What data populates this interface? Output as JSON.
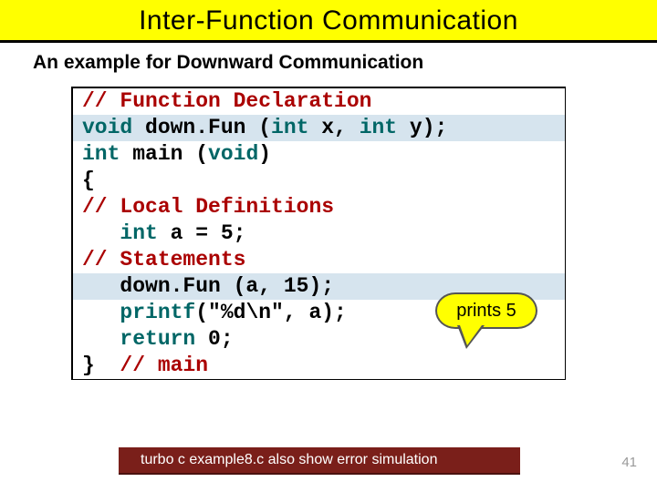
{
  "title": "Inter-Function Communication",
  "subtitle": "An example for Downward Communication",
  "code": {
    "l1": "// Function Declaration",
    "l2a": "void",
    "l2b": " down.Fun (",
    "l2c": "int",
    "l2d": " x, ",
    "l2e": "int",
    "l2f": " y);",
    "l3a": "int",
    "l3b": " main (",
    "l3c": "void",
    "l3d": ")",
    "l4": "{",
    "l5": "// Local Definitions",
    "l6a": "   int",
    "l6b": " a = 5;",
    "l7": "// Statements",
    "l8": "   down.Fun (a, 15);",
    "l9a": "   printf",
    "l9b": "(\"%d\\n\", a);",
    "l10a": "   return",
    "l10b": " 0;",
    "l11a": "}",
    "l11b": "  // main"
  },
  "callout": "prints 5",
  "footer": "turbo c example8.c also show error simulation",
  "page": "41"
}
